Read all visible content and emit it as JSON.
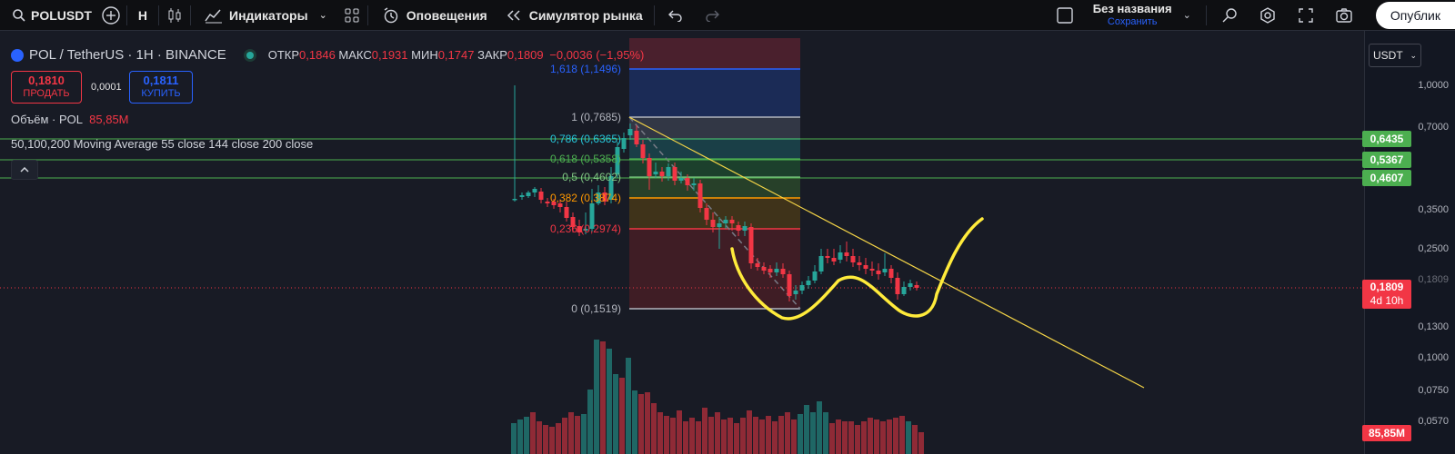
{
  "topbar": {
    "symbol": "POLUSDT",
    "interval": "H",
    "indicators": "Индикаторы",
    "alerts": "Оповещения",
    "replay": "Симулятор рынка",
    "layout_name": "Без названия",
    "layout_save": "Сохранить",
    "publish": "Опублик"
  },
  "legend": {
    "title": "POL / TetherUS · 1H · BINANCE",
    "open_label": "ОТКР",
    "open": "0,1846",
    "high_label": "МАКС",
    "high": "0,1931",
    "low_label": "МИН",
    "low": "0,1747",
    "close_label": "ЗАКР",
    "close": "0,1809",
    "change": "−0,0036 (−1,95%)"
  },
  "trade": {
    "sell_price": "0,1810",
    "sell_label": "ПРОДАТЬ",
    "spread": "0,0001",
    "buy_price": "0,1811",
    "buy_label": "КУПИТЬ"
  },
  "volume_legend": {
    "label": "Объём · POL",
    "value": "85,85M"
  },
  "ma_legend": "50,100,200 Moving Average 55 close 144 close 200 close",
  "currency": "USDT",
  "price_axis": [
    "1,0000",
    "0,7000",
    "0,3500",
    "0,2500",
    "0,1809",
    "0,1300",
    "0,1000",
    "0,0750",
    "0,0570"
  ],
  "price_tags": {
    "ma1": "0,6435",
    "ma2": "0,5367",
    "ma3": "0,4607",
    "last": "0,1809",
    "countdown": "4d 10h",
    "volume": "85,85M"
  },
  "fib_levels": [
    {
      "label": "1,618 (1,1496)",
      "color": "#2962ff"
    },
    {
      "label": "1 (0,7685)",
      "color": "#b2b5be"
    },
    {
      "label": "0,786 (0,6365)",
      "color": "#26c6da"
    },
    {
      "label": "0,618 (0,5358)",
      "color": "#4caf50"
    },
    {
      "label": "0,5 (0,4602)",
      "color": "#81c784"
    },
    {
      "label": "0,382 (0,3874)",
      "color": "#ff9800"
    },
    {
      "label": "0,236 (0,2974)",
      "color": "#f23645"
    },
    {
      "label": "0 (0,1519)",
      "color": "#b2b5be"
    }
  ],
  "colors": {
    "up": "#26a69a",
    "down": "#f23645",
    "ma_line": "#4caf50",
    "drawing": "#ffeb3b",
    "accent": "#2962ff"
  }
}
